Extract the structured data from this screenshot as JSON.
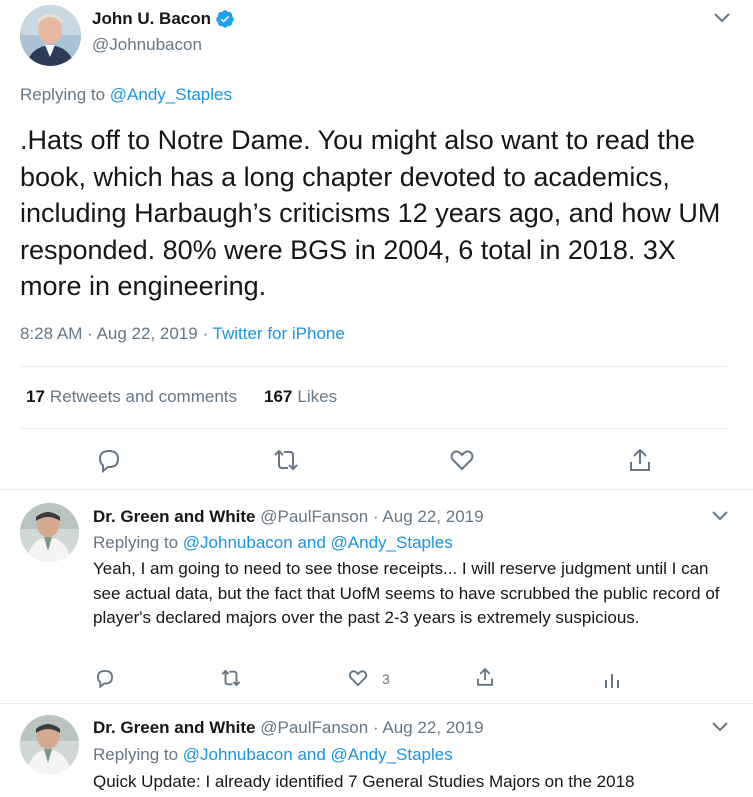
{
  "main_tweet": {
    "author_name": "John U. Bacon",
    "handle": "@Johnubacon",
    "replying_prefix": "Replying to",
    "replying_to": "@Andy_Staples",
    "text": ".Hats off to Notre Dame. You might also want to read the book, which has a long chapter devoted to academics, including Harbaugh’s criticisms 12 years ago, and how UM responded. 80% were BGS in 2004, 6 total in 2018. 3X more in engineering.",
    "time": "8:28 AM",
    "date": "Aug 22, 2019",
    "source": "Twitter for iPhone",
    "retweets_count": "17",
    "retweets_label": "Retweets and comments",
    "likes_count": "167",
    "likes_label": "Likes",
    "icons": [
      "reply-icon",
      "retweet-icon",
      "like-icon",
      "share-icon"
    ]
  },
  "replies": [
    {
      "author_name": "Dr. Green and White",
      "handle": "@PaulFanson",
      "date": "Aug 22, 2019",
      "replying_prefix": "Replying to",
      "replying_to_1": "@Johnubacon",
      "replying_and": "and",
      "replying_to_2": "@Andy_Staples",
      "text": "Yeah, I am going to need to see those receipts... I will reserve judgment until I can see actual data, but the fact that UofM seems to have scrubbed the public record of player's declared majors over the past 2-3 years is extremely suspicious.",
      "likes_count": "3"
    },
    {
      "author_name": "Dr. Green and White",
      "handle": "@PaulFanson",
      "date": "Aug 22, 2019",
      "replying_prefix": "Replying to",
      "replying_to_1": "@Johnubacon",
      "replying_and": "and",
      "replying_to_2": "@Andy_Staples",
      "text": "Quick Update: I already identified 7 General Studies Majors on the 2018"
    }
  ],
  "colors": {
    "link": "#1b95e0",
    "secondary": "#657786",
    "primary": "#14171a",
    "divider": "#e6ecf0"
  }
}
